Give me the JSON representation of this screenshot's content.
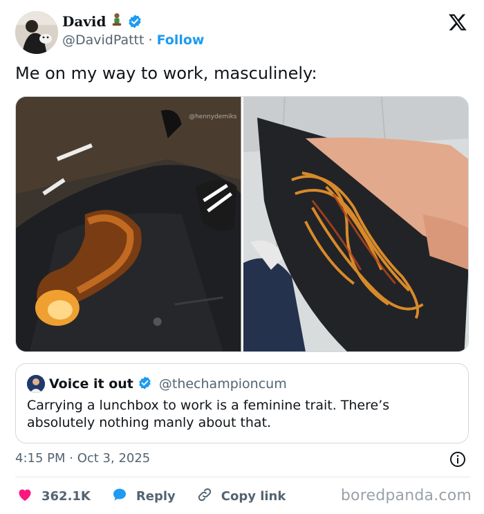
{
  "author": {
    "display_name": "David",
    "handle": "@DavidPattt",
    "separator": " · ",
    "follow_label": "Follow"
  },
  "icons": {
    "x_logo": "x-logo-icon",
    "verified": "verified-badge-icon",
    "info": "info-icon",
    "like": "heart-icon",
    "reply": "speech-bubble-icon",
    "copy_link": "link-icon"
  },
  "tweet": {
    "text": "Me on my way to work, masculinely:",
    "watermark": "@hennydemiks"
  },
  "quote": {
    "display_name": "Voice it out",
    "handle": "@thechampioncum",
    "text": "Carrying a lunchbox to work is a feminine trait. There’s absolutely nothing manly about that."
  },
  "meta": {
    "time": "4:15 PM",
    "separator": " · ",
    "date": "Oct 3, 2025"
  },
  "actions": {
    "likes": "362.1K",
    "reply_label": "Reply",
    "copy_link_label": "Copy link"
  },
  "brand": "boredpanda.com",
  "colors": {
    "accent": "#1d9bf0",
    "like": "#f91880",
    "secondary_text": "#536471"
  }
}
